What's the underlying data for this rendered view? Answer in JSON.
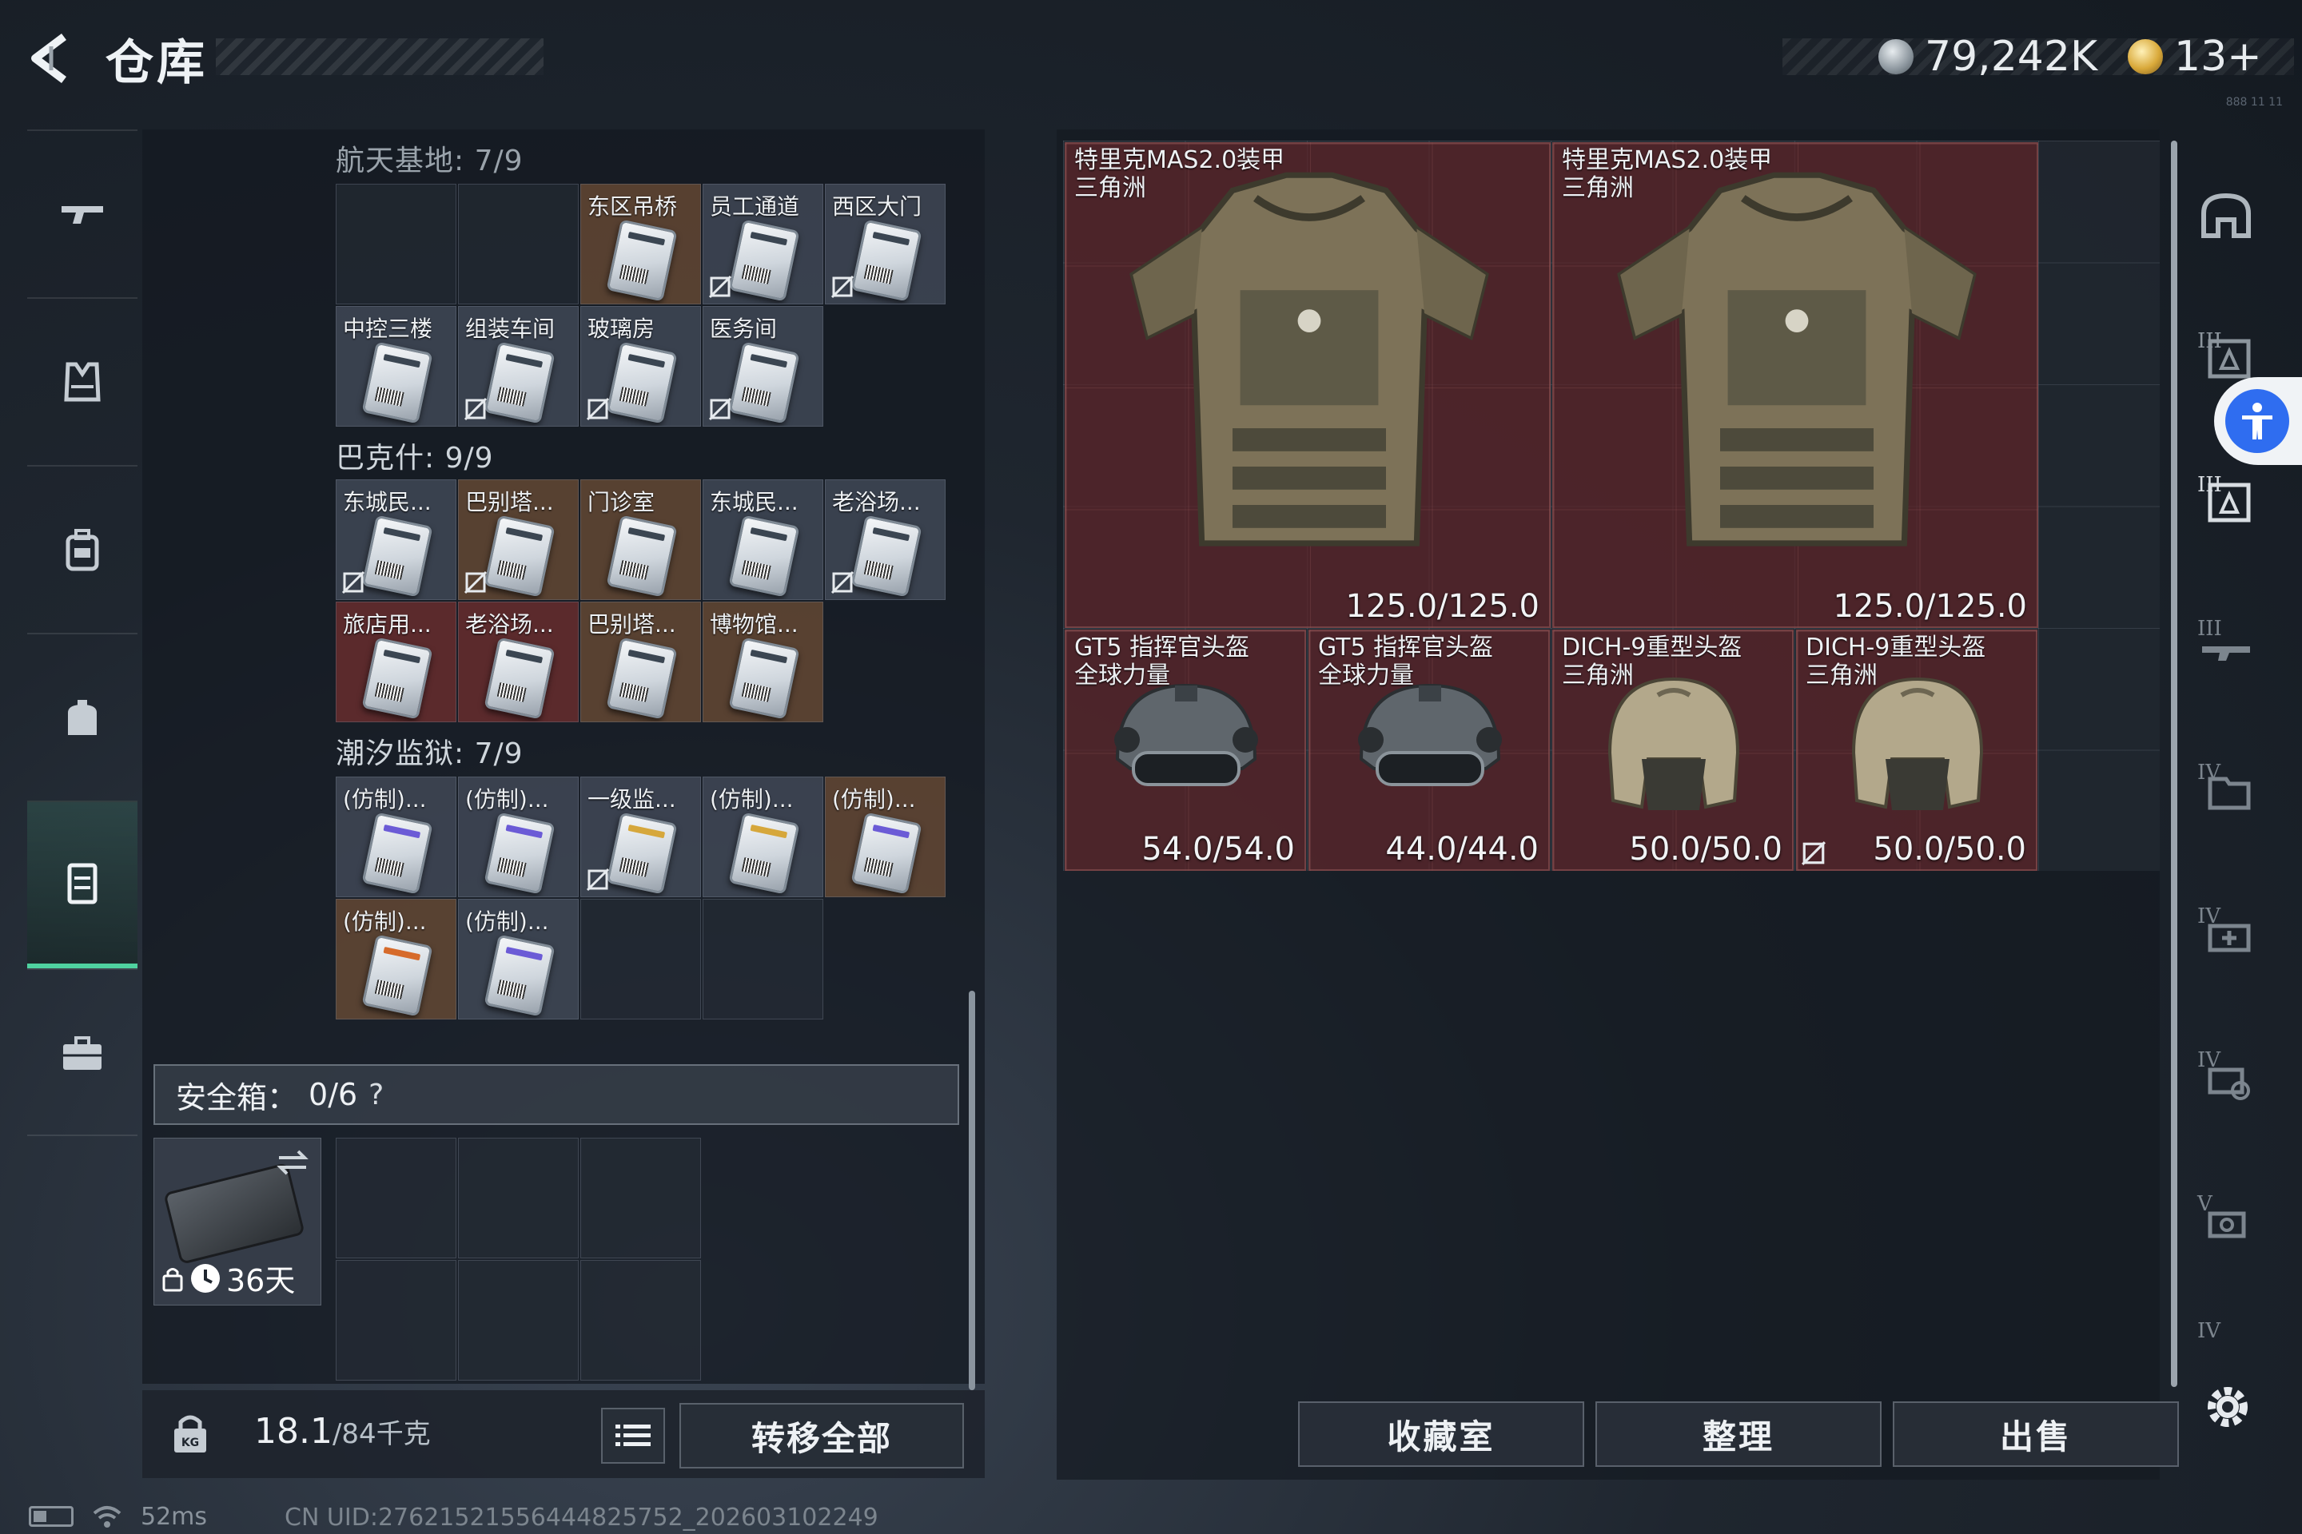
{
  "header": {
    "title": "仓库",
    "currency_silver": "79,242K",
    "currency_gold": "13+",
    "corner_note": "888 11 11"
  },
  "sections": [
    {
      "title": "航天基地: 7/9",
      "cells": [
        {
          "label": "",
          "empty": true
        },
        {
          "label": "",
          "empty": true
        },
        {
          "label": "东区吊桥",
          "rarity": "r-brown",
          "card": "white",
          "nt": false
        },
        {
          "label": "员工通道",
          "rarity": "r-white",
          "card": "white",
          "nt": true
        },
        {
          "label": "西区大门",
          "rarity": "r-white",
          "card": "white",
          "nt": true
        },
        {
          "label": "中控三楼",
          "rarity": "r-white",
          "card": "white",
          "nt": false
        },
        {
          "label": "组装车间",
          "rarity": "r-white",
          "card": "white",
          "nt": true
        },
        {
          "label": "玻璃房",
          "rarity": "r-white",
          "card": "white",
          "nt": true
        },
        {
          "label": "医务间",
          "rarity": "r-white",
          "card": "white",
          "nt": true
        }
      ]
    },
    {
      "title": "巴克什: 9/9",
      "cells": [
        {
          "label": "东城民...",
          "rarity": "r-white",
          "card": "white",
          "nt": true
        },
        {
          "label": "巴别塔...",
          "rarity": "r-brown",
          "card": "white",
          "nt": true
        },
        {
          "label": "门诊室",
          "rarity": "r-brown",
          "card": "white",
          "nt": false
        },
        {
          "label": "东城民...",
          "rarity": "r-white",
          "card": "white",
          "nt": false
        },
        {
          "label": "老浴场...",
          "rarity": "r-white",
          "card": "white",
          "nt": true
        },
        {
          "label": "旅店用...",
          "rarity": "r-red",
          "card": "white",
          "nt": false
        },
        {
          "label": "老浴场...",
          "rarity": "r-red",
          "card": "white",
          "nt": false
        },
        {
          "label": "巴别塔...",
          "rarity": "r-brown",
          "card": "white",
          "nt": false
        },
        {
          "label": "博物馆...",
          "rarity": "r-brown",
          "card": "white",
          "nt": false
        }
      ]
    },
    {
      "title": "潮汐监狱: 7/9",
      "cells": [
        {
          "label": "(仿制)...",
          "rarity": "r-white",
          "card": "purple",
          "nt": false
        },
        {
          "label": "(仿制)...",
          "rarity": "r-white",
          "card": "purple",
          "nt": false
        },
        {
          "label": "一级监...",
          "rarity": "r-white",
          "card": "yellow",
          "nt": true
        },
        {
          "label": "(仿制)...",
          "rarity": "r-white",
          "card": "yellow",
          "nt": false
        },
        {
          "label": "(仿制)...",
          "rarity": "r-brown",
          "card": "purple",
          "nt": false
        },
        {
          "label": "(仿制)...",
          "rarity": "r-brown",
          "card": "orange",
          "nt": false
        },
        {
          "label": "(仿制)...",
          "rarity": "r-white",
          "card": "purple",
          "nt": false
        },
        {
          "label": "",
          "empty": true
        },
        {
          "label": "",
          "empty": true
        }
      ]
    }
  ],
  "safebox": {
    "label": "安全箱：",
    "count": "0/6",
    "help": "?",
    "days": "36天"
  },
  "footer_left": {
    "weight": "18.1",
    "weight_cap": "/84千克",
    "transfer_all": "转移全部"
  },
  "equipment": [
    {
      "name1": "特里克MAS2.0装甲",
      "name2": "三角洲",
      "durability": "125.0/125.0",
      "kind": "armor"
    },
    {
      "name1": "特里克MAS2.0装甲",
      "name2": "三角洲",
      "durability": "125.0/125.0",
      "kind": "armor"
    },
    {
      "name1": "GT5 指挥官头盔",
      "name2": "全球力量",
      "durability": "54.0/54.0",
      "kind": "helmet-tactical"
    },
    {
      "name1": "GT5 指挥官头盔",
      "name2": "全球力量",
      "durability": "44.0/44.0",
      "kind": "helmet-tactical"
    },
    {
      "name1": "DICH-9重型头盔",
      "name2": "三角洲",
      "durability": "50.0/50.0",
      "kind": "helmet-heavy"
    },
    {
      "name1": "DICH-9重型头盔",
      "name2": "三角洲",
      "durability": "50.0/50.0",
      "kind": "helmet-heavy"
    }
  ],
  "actions": {
    "collection": "收藏室",
    "organize": "整理",
    "sell": "出售"
  },
  "rail_labels": [
    "",
    "III",
    "III",
    "III",
    "IV",
    "IV",
    "IV",
    "V",
    "IV"
  ],
  "status": {
    "ping": "52ms",
    "uid": "CN UID:27621521556444825752_202603102249"
  },
  "colors": {
    "accent_green": "#4fd2a0",
    "equip_red": "#602428",
    "accessibility_blue": "#2f6df0"
  }
}
